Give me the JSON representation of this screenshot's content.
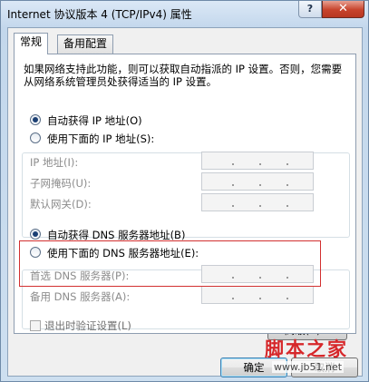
{
  "window": {
    "title": "Internet 协议版本 4 (TCP/IPv4) 属性",
    "help_label": "?",
    "close_label": "✕"
  },
  "tabs": [
    {
      "label": "常规",
      "active": true
    },
    {
      "label": "备用配置",
      "active": false
    }
  ],
  "description": "如果网络支持此功能，则可以获取自动指派的 IP 设置。否则，您需要从网络系统管理员处获得适当的 IP 设置。",
  "ip_section": {
    "auto_label": "自动获得 IP 地址(O)",
    "auto_checked": true,
    "manual_label": "使用下面的 IP 地址(S):",
    "manual_checked": false,
    "fields": [
      {
        "label": "IP 地址(I):",
        "value": ""
      },
      {
        "label": "子网掩码(U):",
        "value": ""
      },
      {
        "label": "默认网关(D):",
        "value": ""
      }
    ]
  },
  "dns_section": {
    "auto_label": "自动获得 DNS 服务器地址(B)",
    "auto_checked": true,
    "manual_label": "使用下面的 DNS 服务器地址(E):",
    "manual_checked": false,
    "fields": [
      {
        "label": "首选 DNS 服务器(P):",
        "value": ""
      },
      {
        "label": "备用 DNS 服务器(A):",
        "value": ""
      }
    ]
  },
  "validate_checkbox": {
    "label": "退出时验证设置(L)",
    "checked": false
  },
  "buttons": {
    "advanced": "高级(V)...",
    "ok": "确定",
    "cancel": "取消"
  },
  "watermark": {
    "main": "脚本之家",
    "sub": "www.jb51.net"
  },
  "colors": {
    "highlight_box": "#d23030",
    "title_bar": "#c3d7ec",
    "close_button": "#c7432c"
  }
}
